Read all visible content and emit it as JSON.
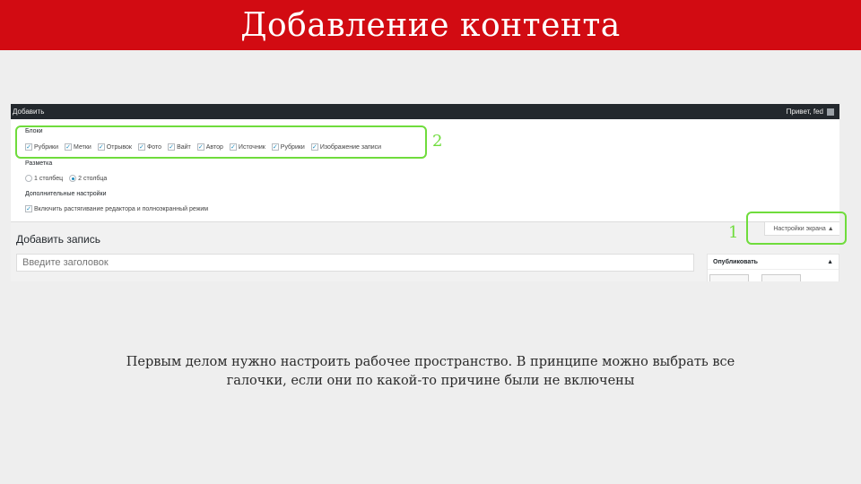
{
  "slide": {
    "title": "Добавление контента",
    "caption_line1": "Первым делом нужно настроить рабочее пространство. В принципе можно выбрать все",
    "caption_line2": "галочки, если они по какой-то причине были не включены"
  },
  "admin_bar": {
    "left_label": "Добавить",
    "right_label": "Привет, fed"
  },
  "screen_options_panel": {
    "blocks_label": "Блоки",
    "blocks": [
      {
        "label": "Рубрики",
        "checked": true
      },
      {
        "label": "Метки",
        "checked": true
      },
      {
        "label": "Отрывок",
        "checked": true
      },
      {
        "label": "Фото",
        "checked": true
      },
      {
        "label": "Вайт",
        "checked": true
      },
      {
        "label": "Автор",
        "checked": true
      },
      {
        "label": "Источник",
        "checked": true
      },
      {
        "label": "Рубрики",
        "checked": true
      },
      {
        "label": "Изображение записи",
        "checked": true
      }
    ],
    "layout_label": "Разметка",
    "layout_options": [
      {
        "label": "1 столбец",
        "selected": false
      },
      {
        "label": "2 столбца",
        "selected": true
      }
    ],
    "extra_label": "Дополнительные настройки",
    "extra_option": {
      "label": "Включить растягивание редактора и полноэкранный режим",
      "checked": true
    }
  },
  "markers": {
    "one": "1",
    "two": "2"
  },
  "screen_options_button": {
    "label": "Настройки экрана ▲"
  },
  "editor": {
    "page_title": "Добавить запись",
    "title_placeholder": "Введите заголовок",
    "publish_box_title": "Опубликовать",
    "publish_toggle": "▲"
  },
  "colors": {
    "title_bar": "#d20b12",
    "highlight": "#6fdc3c",
    "admin_bar": "#23282d",
    "checkbox_accent": "#1e8cbe"
  }
}
